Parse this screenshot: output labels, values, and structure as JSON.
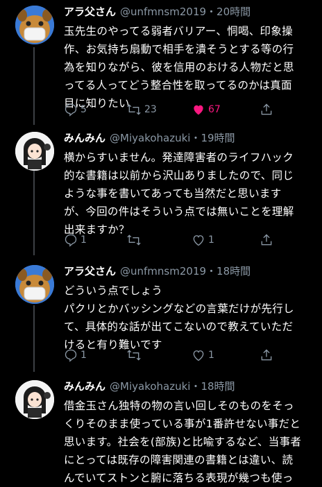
{
  "tweets": [
    {
      "name": "アラ父さん",
      "handle": "@unfmnsm2019",
      "time": "・20時間",
      "lines": [
        "玉先生のやってる弱者バリアー、恫喝、印象操",
        "作、お気持ち扇動で相手を潰そうとする等の行",
        "為を知りながら、彼を信用のおける人物だと思",
        "ってる人ってどう整合性を取ってるのかは真面",
        "目に知りたい"
      ],
      "replies": "5",
      "retweets": "23",
      "likes": "67",
      "liked": true
    },
    {
      "name": "みんみん",
      "handle": "@Miyakohazuki",
      "time": "・19時間",
      "lines": [
        "横からすいません。発達障害者のライフハック",
        "的な書籍は以前から沢山ありましたので、同じ",
        "ような事を書いてあっても当然だと思います",
        "が、今回の件はそういう点では無いことを理解",
        "出来ますか？"
      ],
      "replies": "1",
      "retweets": "",
      "likes": "1",
      "liked": false
    },
    {
      "name": "アラ父さん",
      "handle": "@unfmnsm2019",
      "time": "・18時間",
      "lines": [
        "どういう点でしょう",
        "パクリとかバッシングなどの言葉だけが先行し",
        "て、具体的な話が出てこないので教えていただ",
        "けると有り難いです"
      ],
      "replies": "1",
      "retweets": "",
      "likes": "1",
      "liked": false
    },
    {
      "name": "みんみん",
      "handle": "@Miyakohazuki",
      "time": "・18時間",
      "lines": [
        "借金玉さん独特の物の言い回しそのものをそっ",
        "くりそのまま使っている事が1番許せない事だと",
        "思います。社会を(部族)と比喩するなど、当事者",
        "にとっては既存の障害関連の書籍とは違い、読",
        "んでいてストンと腑に落ちる表現が幾つも使っ"
      ]
    }
  ],
  "colors": {
    "accent": "#1d9bf0",
    "like": "#f91880",
    "muted": "#8b98a5"
  }
}
